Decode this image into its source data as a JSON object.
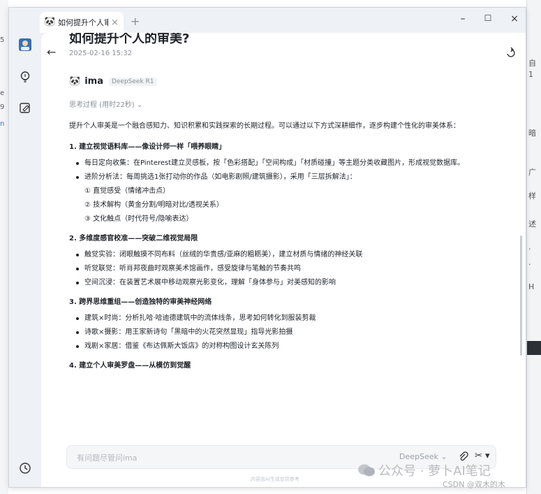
{
  "window": {
    "tab_icon": "🐼",
    "tab_title": "如何提升个人审美",
    "tab_close": "×",
    "new_tab": "+",
    "minimize": "–",
    "maximize": "☐",
    "close": "×"
  },
  "sidebar": {
    "items": [
      {
        "icon": "avatar"
      },
      {
        "icon": "lightbulb-icon"
      },
      {
        "icon": "edit-icon"
      },
      {
        "icon": "clock-icon"
      }
    ]
  },
  "doc": {
    "back": "←",
    "title": "如何提升个人的审美?",
    "date": "2025-02-16 15:32",
    "ai_logo": "🐼",
    "ai_name": "ima",
    "ai_model": "DeepSeek R1",
    "think": "思考过程 (用时22秒) ⌄",
    "intro": "提升个人审美是一个融合感知力、知识积累和实践探索的长期过程。可以通过以下方式深耕细作，逐步构建个性化的审美体系：",
    "s1_title": "1. 建立视觉语料库——像设计师一样「喂养眼睛」",
    "s1_b1": "每日定向收集：在Pinterest建立灵感板，按「色彩搭配」「空间构成」「材质碰撞」等主题分类收藏图片，形成视觉数据库。",
    "s1_b2": "进阶分析法：每周挑选1张打动你的作品（如电影剧照/建筑摄影），采用「三层拆解法」：",
    "s1_sub1": "① 直觉感受（情绪冲击点）",
    "s1_sub2": "② 技术解构（黄金分割/明暗对比/透视关系）",
    "s1_sub3": "③ 文化触点（时代符号/隐喻表达）",
    "s2_title": "2. 多维度感官校准——突破二维视觉局限",
    "s2_b1": "触觉实验：闭眼触摸不同布料（丝绒的华贵感/亚麻的粗粝美），建立材质与情绪的神经关联",
    "s2_b2": "听觉联觉：听肖邦夜曲时观察美术馆画作，感受旋律与笔触的节奏共鸣",
    "s2_b3": "空间沉浸：在装置艺术展中移动观察光影变化，理解「身体参与」对美感知的影响",
    "s3_title": "3. 跨界思维重组——创造独特的审美神经网络",
    "s3_b1": "建筑×时尚：分析扎哈·哈迪德建筑中的流体线条，思考如何转化到服装剪裁",
    "s3_b2": "诗歌×摄影：用王家新诗句「黑暗中的火花突然显现」指导光影拍摄",
    "s3_b3": "戏剧×家居：借鉴《布达佩斯大饭店》的对称构图设计玄关陈列",
    "s4_title": "4. 建立个人审美罗盘——从模仿到觉醒"
  },
  "input": {
    "placeholder": "有问题尽管问ima",
    "model": "DeepSeek ⌄",
    "scissor": "✂ ▾",
    "footnote": "内容由AI生成仅供参考"
  },
  "watermark": {
    "text": "公众号 · 萝卜AI笔记",
    "csdn": "CSDN @双木的木"
  },
  "background": {
    "left_chars": [
      "5",
      "e",
      "9",
      "n"
    ],
    "right_chars": [
      "自",
      "1",
      "暗",
      "广",
      "样",
      "述",
      "·",
      "·",
      "H"
    ]
  }
}
